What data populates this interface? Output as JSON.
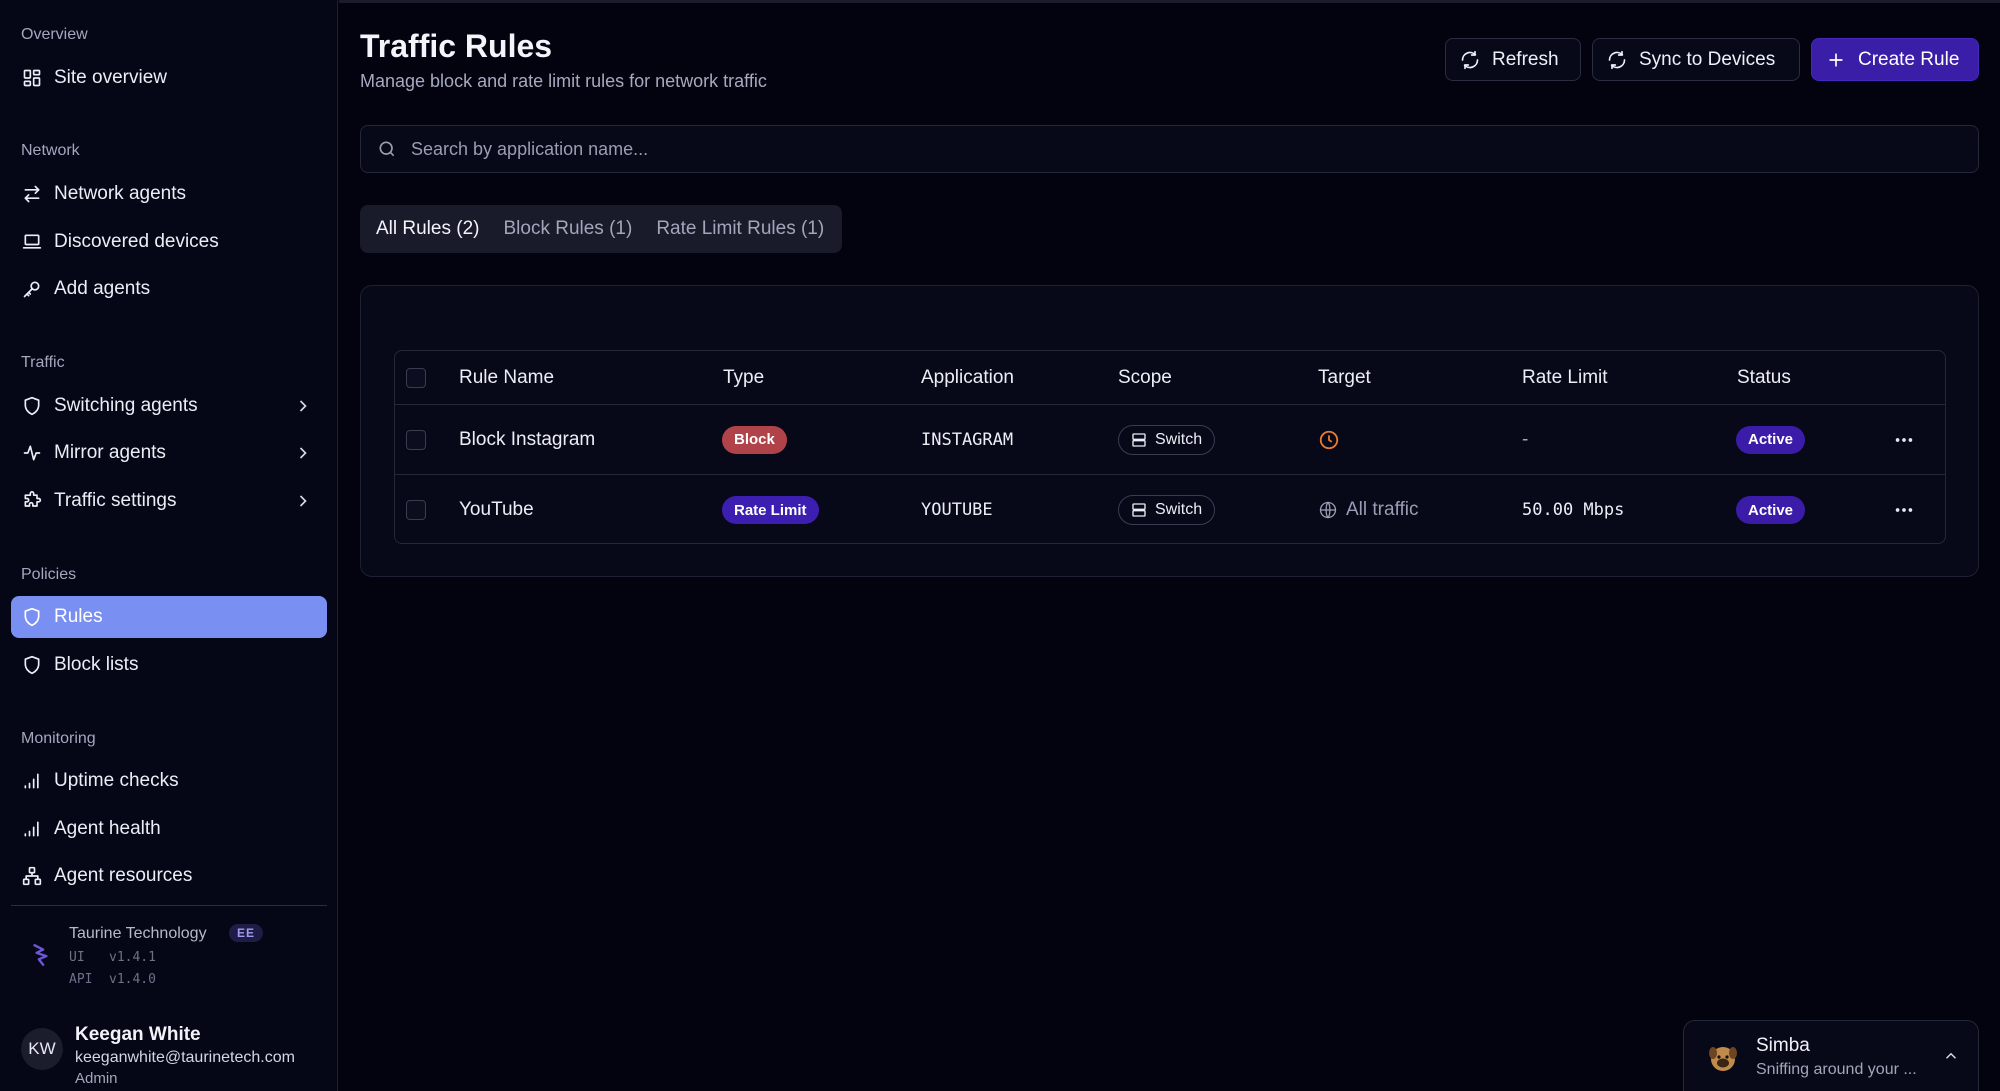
{
  "sidebar": {
    "sections": {
      "overview": "Overview",
      "network": "Network",
      "traffic": "Traffic",
      "policies": "Policies",
      "monitoring": "Monitoring"
    },
    "items": {
      "site_overview": "Site overview",
      "network_agents": "Network agents",
      "discovered_devices": "Discovered devices",
      "add_agents": "Add agents",
      "switching_agents": "Switching agents",
      "mirror_agents": "Mirror agents",
      "traffic_settings": "Traffic settings",
      "rules": "Rules",
      "block_lists": "Block lists",
      "uptime_checks": "Uptime checks",
      "agent_health": "Agent health",
      "agent_resources": "Agent resources"
    },
    "org": {
      "name": "Taurine Technology",
      "badge": "EE",
      "ui_label": "UI",
      "ui_version": "v1.4.1",
      "api_label": "API",
      "api_version": "v1.4.0"
    },
    "user": {
      "initials": "KW",
      "name": "Keegan White",
      "email": "keeganwhite@taurinetech.com",
      "role": "Admin"
    }
  },
  "header": {
    "title": "Traffic Rules",
    "subtitle": "Manage block and rate limit rules for network traffic",
    "refresh_label": "Refresh",
    "sync_label": "Sync to Devices",
    "create_label": "Create Rule"
  },
  "search": {
    "placeholder": "Search by application name..."
  },
  "tabs": {
    "all": "All Rules (2)",
    "block": "Block Rules (1)",
    "rate": "Rate Limit Rules (1)"
  },
  "table": {
    "columns": {
      "rule_name": "Rule Name",
      "type": "Type",
      "application": "Application",
      "scope": "Scope",
      "target": "Target",
      "rate_limit": "Rate Limit",
      "status": "Status"
    },
    "rows": [
      {
        "rule_name": "Block Instagram",
        "type": "Block",
        "application": "INSTAGRAM",
        "scope": "Switch",
        "target": "",
        "rate_limit": "-",
        "status": "Active"
      },
      {
        "rule_name": "YouTube",
        "type": "Rate Limit",
        "application": "YOUTUBE",
        "scope": "Switch",
        "target": "All traffic",
        "rate_limit": "50.00 Mbps",
        "status": "Active"
      }
    ]
  },
  "assistant": {
    "name": "Simba",
    "status": "Sniffing around your ..."
  },
  "colors": {
    "background": "#03030f",
    "accent": "#3b1ea7",
    "active_nav": "#7a8ff2",
    "block_badge": "#b0434a",
    "clock_icon": "#e77b2f"
  }
}
